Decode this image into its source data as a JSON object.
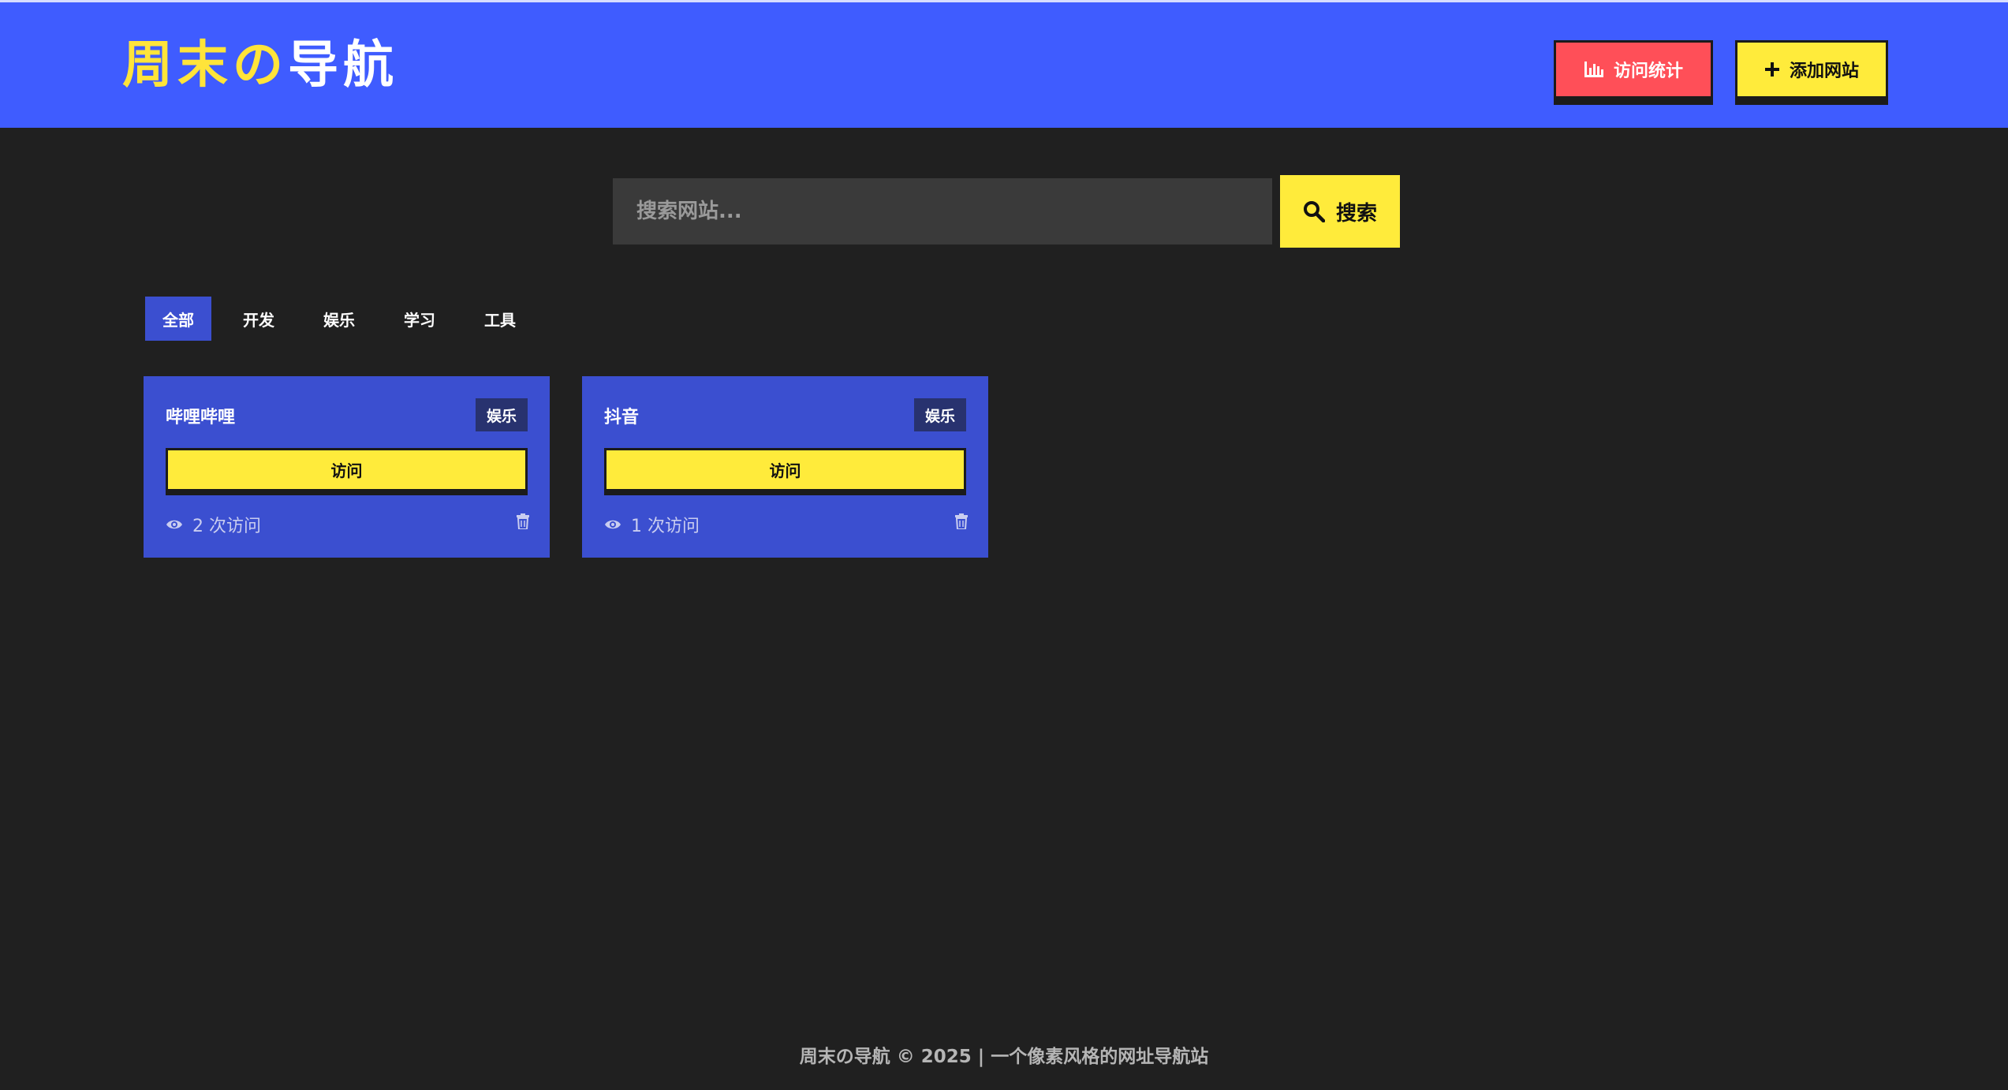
{
  "header": {
    "logo_part1": "周末",
    "logo_part2": "の",
    "logo_part3": "导航",
    "stats_button": "访问统计",
    "add_button": "添加网站"
  },
  "search": {
    "placeholder": "搜索网站...",
    "button_label": "搜索"
  },
  "tabs": [
    {
      "label": "全部",
      "active": true
    },
    {
      "label": "开发",
      "active": false
    },
    {
      "label": "娱乐",
      "active": false
    },
    {
      "label": "学习",
      "active": false
    },
    {
      "label": "工具",
      "active": false
    }
  ],
  "cards": [
    {
      "title": "哔哩哔哩",
      "tag": "娱乐",
      "visit_label": "访问",
      "visits_text": "2 次访问"
    },
    {
      "title": "抖音",
      "tag": "娱乐",
      "visit_label": "访问",
      "visits_text": "1 次访问"
    }
  ],
  "footer": {
    "text": "周末の导航 © 2025 | 一个像素风格的网址导航站"
  },
  "colors": {
    "header_bg": "#3f5cff",
    "page_bg": "#202020",
    "card_bg": "#3b4fd0",
    "accent_yellow": "#ffeb3b",
    "accent_red": "#ff4f58"
  },
  "icons": {
    "stats": "bar-chart-icon",
    "add": "plus-icon",
    "search": "search-icon",
    "visits": "eye-icon",
    "delete": "trash-icon"
  }
}
